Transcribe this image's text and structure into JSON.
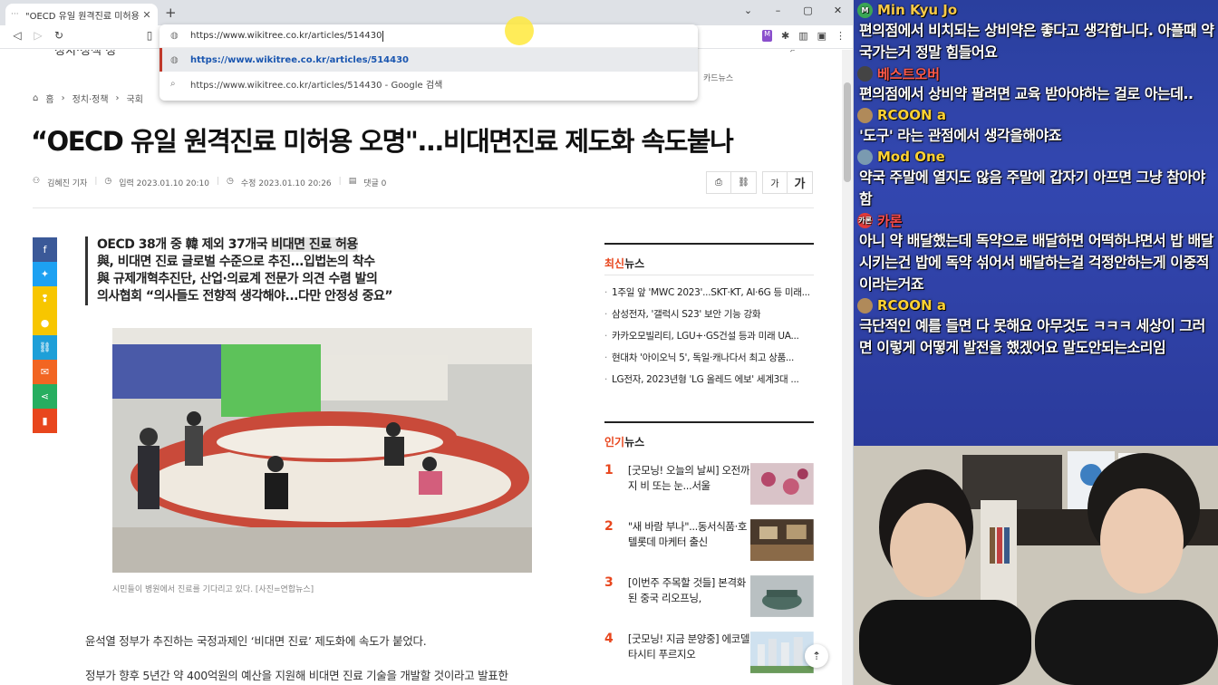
{
  "browser": {
    "tab_title": "\"OECD 유일 원격진료 미허용 오명",
    "url": "https://www.wikitree.co.kr/articles/514430",
    "suggestion_1": "https://www.wikitree.co.kr/articles/514430",
    "suggestion_2": "https://www.wikitree.co.kr/articles/514430 - Google 검색"
  },
  "page": {
    "gnb_fragment": "정치·정책    정",
    "gnb_right": "카드뉴스",
    "breadcrumb": [
      "홈",
      "정치·정책",
      "국회"
    ],
    "headline": "“OECD 유일 원격진료 미허용 오명\"...비대면진료 제도화 속도붙나",
    "author": "김혜진 기자",
    "published": "입력 2023.01.10 20:10",
    "updated": "수정 2023.01.10 20:26",
    "comments": "댓글 0",
    "font_small": "가",
    "font_large": "가",
    "summary": [
      {
        "pre": "OECD 38개 중 韓 제외 37개국 ",
        "hl": "비대면 진료 허용"
      },
      {
        "pre": "與, 비대면 진료 글로벌 수준으로 추진...입법논의 착수",
        "hl": ""
      },
      {
        "pre": "與 규제개혁추진단, 산업·의료계 전문가 의견 수렴 발의",
        "hl": ""
      },
      {
        "pre": "의사협회 “의사들도 전향적 생각해야...다만 안정성 중요”",
        "hl": ""
      }
    ],
    "caption": "시민들이 병원에서 진료를 기다리고 있다. [사진=연합뉴스]",
    "body_1": "윤석열 정부가 추진하는 국정과제인 ‘비대면 진료’ 제도화에 속도가 붙었다.",
    "body_2": "정부가 향후 5년간 약 400억원의 예산을 지원해 비대면 진료 기술을 개발할 것이라고 발표한"
  },
  "latest": {
    "title_accent": "최신",
    "title_rest": "뉴스",
    "items": [
      "1주일 앞 'MWC 2023'...SKT·KT, AI·6G 등 미래...",
      "삼성전자, '갤럭시 S23' 보안 기능 강화",
      "카카오모빌리티, LGU+·GS건설 등과 미래 UA...",
      "현대차 '아이오닉 5', 독일·캐나다서 최고 상품...",
      "LG전자, 2023년형 'LG 올레드 에보' 세계3대 ..."
    ]
  },
  "popular": {
    "title_accent": "인기",
    "title_rest": "뉴스",
    "items": [
      {
        "num": "1",
        "text": "[굿모닝! 오늘의 날씨] 오전까지 비 또는 눈...서울"
      },
      {
        "num": "2",
        "text": "\"새 바람 부나\"...동서식품·호텔롯데 마케터 출신"
      },
      {
        "num": "3",
        "text": "[이번주 주목할 것들] 본격화된 중국 리오프닝,"
      },
      {
        "num": "4",
        "text": "[굿모닝! 지금 분양중] 에코델타시티 푸르지오"
      }
    ]
  },
  "chat": [
    {
      "name": "Min Kyu Jo",
      "color": "#f7c948",
      "av_color": "#3aa655",
      "av": "M",
      "text": "편의점에서 비치되는 상비약은 좋다고 생각합니다. 아플때 약국가는거 정말 힘들어요"
    },
    {
      "name": "베스트오버",
      "color": "#ff5a4a",
      "av_color": "#444",
      "av": "",
      "text": "편의점에서 상비약 팔려면 교육 받아야하는 걸로 아는데.."
    },
    {
      "name": "RCOON a",
      "color": "#ffd233",
      "av_color": "#b08a5a",
      "av": "",
      "text": "'도구' 라는 관점에서 생각을해야죠"
    },
    {
      "name": "Mod One",
      "color": "#ffd233",
      "av_color": "#7a9ab0",
      "av": "",
      "text": "약국 주말에 열지도 않음 주말에 갑자기 아프면 그냥 참아야 함"
    },
    {
      "name": "카론",
      "color": "#ff4d4d",
      "av_color": "#e03a3a",
      "av": "카론",
      "text": "아니 약 배달했는데 독약으로 배달하면 어떡하냐면서 밥 배달시키는건 밥에 독약 섞어서 배달하는걸 걱정안하는게 이중적이라는거죠"
    },
    {
      "name": "RCOON a",
      "color": "#ffd233",
      "av_color": "#b08a5a",
      "av": "",
      "text": "극단적인 예를 들면 다 못해요 아무것도 ㅋㅋㅋ 세상이 그러면 이렇게 어떻게 발전을 했겠어요 말도안되는소리임"
    }
  ],
  "colors": {
    "accent": "#e8461d",
    "share": [
      "#3b5998",
      "#1da1f2",
      "#f7c600",
      "#f7c600",
      "#1e9fd8",
      "#f26522",
      "#27ae60",
      "#e8461d"
    ]
  }
}
